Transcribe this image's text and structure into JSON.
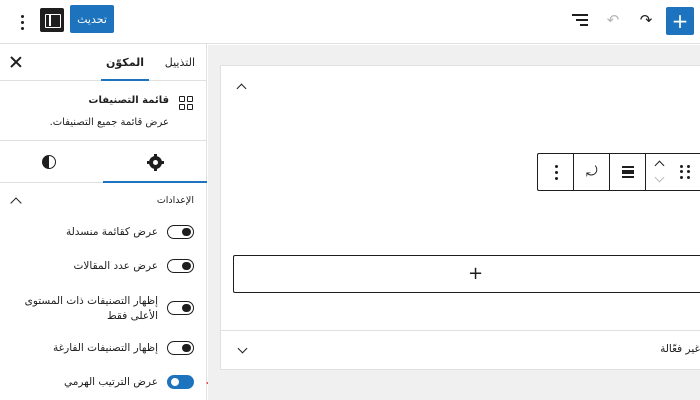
{
  "toolbar": {
    "update_label": "تحديث",
    "icons": [
      "more-options-icon",
      "sidebar-toggle-icon",
      "list-view-icon",
      "undo-icon",
      "redo-icon",
      "add-block-icon"
    ]
  },
  "sidebar": {
    "tabs": {
      "settings": "التذييل",
      "block": "المكوّن"
    },
    "block_card": {
      "title": "قائمة التصنيفات",
      "description": "عرض قائمة جميع التصنيفات."
    },
    "panel_title": "الإعدادات",
    "toggles": [
      {
        "label": "عرض كقائمة منسدلة",
        "on": false
      },
      {
        "label": "عرض عدد المقالات",
        "on": false
      },
      {
        "label": "إظهار التصنيفات ذات المستوى الأعلى فقط",
        "on": false
      },
      {
        "label": "إظهار التصنيفات الفارغة",
        "on": false
      },
      {
        "label": "عرض الترتيب الهرمي",
        "on": true
      }
    ]
  },
  "canvas": {
    "appender_label": "+",
    "collapsed_block_label": "غير فعّالة"
  },
  "colors": {
    "accent": "#1e73be",
    "annotation_arrow": "#e8273b"
  }
}
